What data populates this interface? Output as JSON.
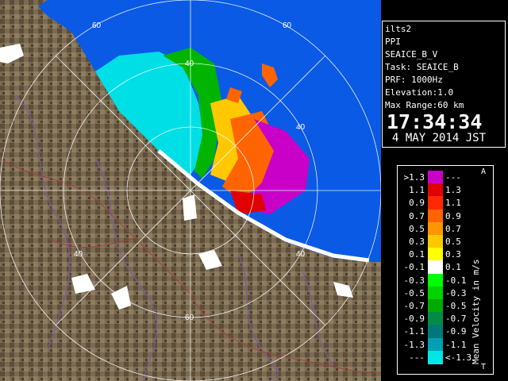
{
  "info": {
    "station": "ilts2",
    "scan_type": "PPI",
    "product": "SEAICE_B_V",
    "task": "Task: SEAICE_B",
    "prf": "PRF: 1000Hz",
    "elevation": "Elevation:1.0",
    "max_range": "Max Range:60 km",
    "time": "17:34:34",
    "date": "4 MAY 2014 JST"
  },
  "range_labels": [
    "60",
    "60",
    "40",
    "40",
    "40",
    "40",
    "60"
  ],
  "legend": {
    "title": "Mean Velocity in m/s",
    "corner_top": "A",
    "corner_bottom": "T",
    "rows": [
      {
        "left": ">1.3",
        "right": "---",
        "color": "#c800c8"
      },
      {
        "left": "1.1",
        "right": "1.3",
        "color": "#e00000"
      },
      {
        "left": "0.9",
        "right": "1.1",
        "color": "#ff2800"
      },
      {
        "left": "0.7",
        "right": "0.9",
        "color": "#ff6400"
      },
      {
        "left": "0.5",
        "right": "0.7",
        "color": "#ff9600"
      },
      {
        "left": "0.3",
        "right": "0.5",
        "color": "#ffc800"
      },
      {
        "left": "0.1",
        "right": "0.3",
        "color": "#ffff00"
      },
      {
        "left": "-0.1",
        "right": "0.1",
        "color": "#ffffff"
      },
      {
        "left": "-0.3",
        "right": "-0.1",
        "color": "#00ff00"
      },
      {
        "left": "-0.5",
        "right": "-0.3",
        "color": "#00d200"
      },
      {
        "left": "-0.7",
        "right": "-0.5",
        "color": "#00aa00"
      },
      {
        "left": "-0.9",
        "right": "-0.7",
        "color": "#008c46"
      },
      {
        "left": "-1.1",
        "right": "-0.9",
        "color": "#007878"
      },
      {
        "left": "-1.3",
        "right": "-1.1",
        "color": "#00a0b4"
      },
      {
        "left": "---",
        "right": "<-1.3",
        "color": "#00e6e6"
      }
    ]
  },
  "colors": {
    "sea": "#0a5ae6",
    "land": "#7a6a50",
    "clutter": "#ffffff",
    "echo_near_range": "#00e6e6",
    "range_ring": "#ffffff"
  }
}
